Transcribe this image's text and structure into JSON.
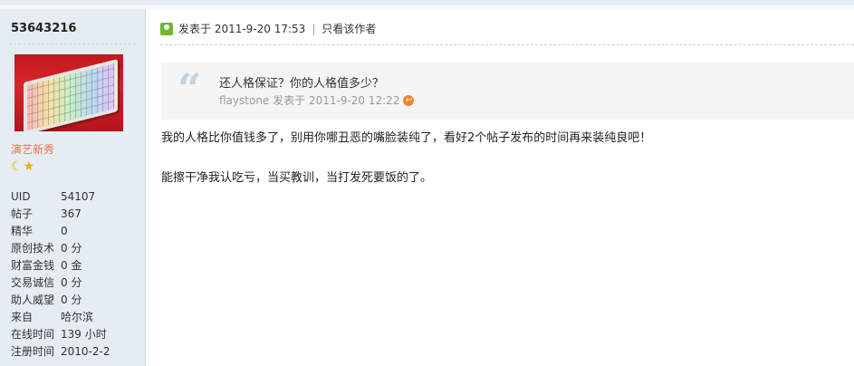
{
  "user": {
    "name": "53643216",
    "group": "演艺新秀",
    "badges": "☾★",
    "stats": [
      {
        "key": "UID",
        "value": "54107"
      },
      {
        "key": "帖子",
        "value": "367"
      },
      {
        "key": "精华",
        "value": "0"
      },
      {
        "key": "原创技术",
        "value": "0 分"
      },
      {
        "key": "财富金钱",
        "value": "0 金"
      },
      {
        "key": "交易诚信",
        "value": "0 分"
      },
      {
        "key": "助人威望",
        "value": "0 分"
      },
      {
        "key": "来自",
        "value": "哈尔滨"
      },
      {
        "key": "在线时间",
        "value": "139 小时"
      },
      {
        "key": "注册时间",
        "value": "2010-2-2"
      }
    ]
  },
  "post": {
    "posted": "发表于 2011-9-20 17:53",
    "separator": "|",
    "only_author": "只看该作者",
    "quote": {
      "mark": "“",
      "text": "还人格保证？你的人格值多少？",
      "author": "flaystone",
      "posted": "发表于 2011-9-20 12:22"
    },
    "lines": [
      "我的人格比你值钱多了，别用你哪丑恶的嘴脸装纯了，看好2个帖子发布的时间再来装纯良吧！",
      "能擦干净我认吃亏，当买教训，当打发死要饭的了。"
    ]
  },
  "icons": {
    "online": "online-status-icon",
    "back": "back-to-post-icon",
    "avatar": "keyboard-avatar"
  },
  "colors": {
    "sidebar_bg": "#e5edf2",
    "group_text": "#f26c4f",
    "online_icon": "#6fb92b",
    "back_icon": "#f1852d"
  }
}
